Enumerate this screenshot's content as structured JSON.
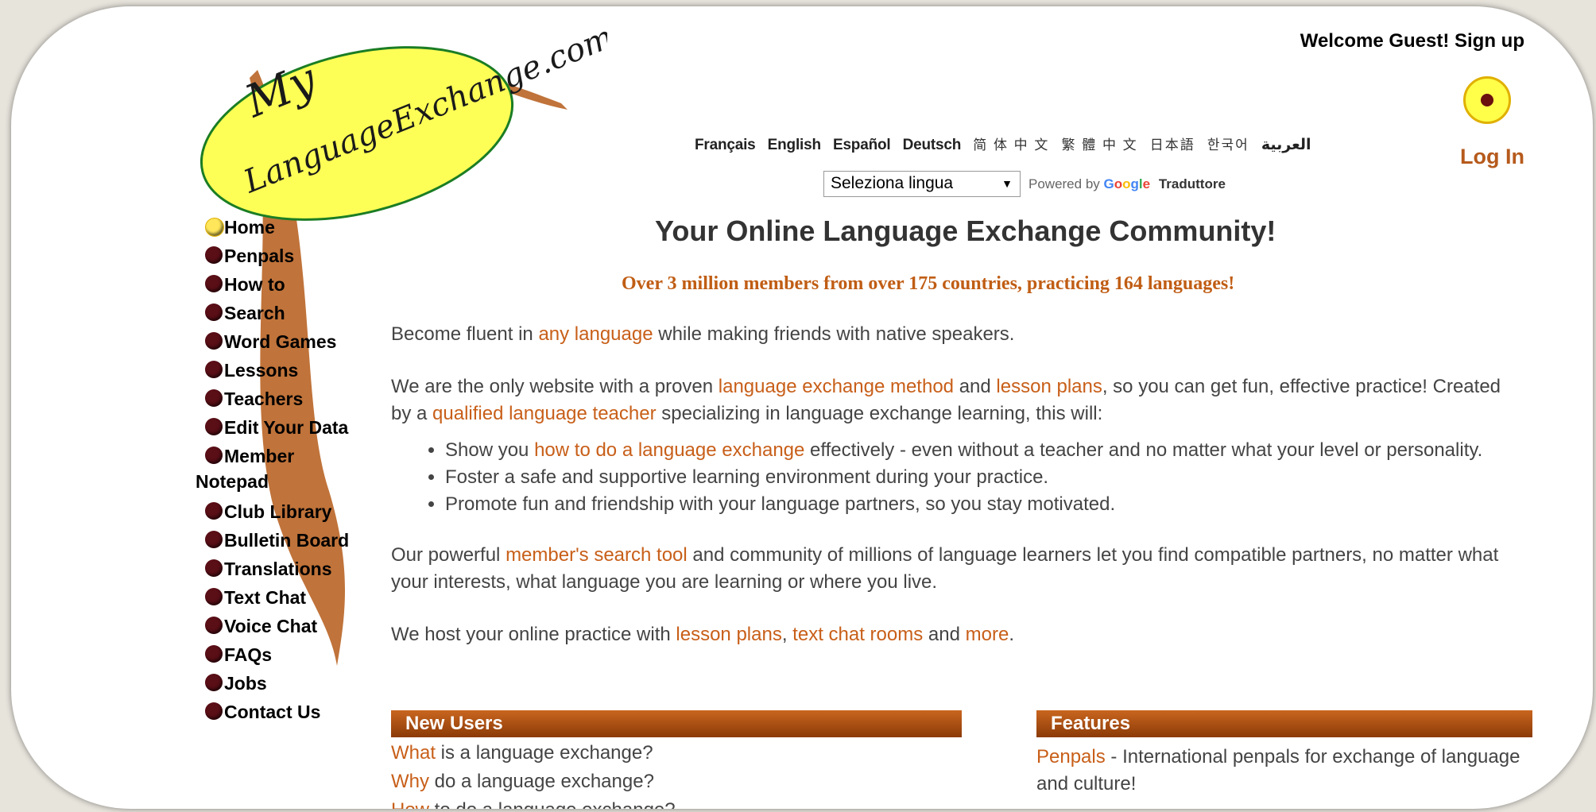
{
  "header": {
    "welcome_text": "Welcome Guest! Sign up",
    "login_label": "Log In"
  },
  "languages": [
    "Français",
    "English",
    "Español",
    "Deutsch",
    "简 体 中 文",
    "繁 體 中 文",
    "日本語",
    "한국어",
    "العربية"
  ],
  "translate": {
    "select_value": "Seleziona lingua",
    "powered_by": "Powered by",
    "google": "Google",
    "translator": "Traduttore"
  },
  "main": {
    "headline": "Your Online Language Exchange Community!",
    "subheadline": "Over 3 million members from over 175 countries, practicing 164 languages!",
    "p1": {
      "a": "Become fluent in ",
      "link1": "any language",
      "b": " while making friends with native speakers."
    },
    "p2": {
      "a": "We are the only website with a proven ",
      "link1": "language exchange method",
      "b": " and ",
      "link2": "lesson plans",
      "c": ", so you can get fun, effective practice! Created by a ",
      "link3": "qualified language teacher",
      "d": " specializing in language exchange learning, this will:"
    },
    "bullets": {
      "b1a": "Show you ",
      "b1link": "how to do a language exchange",
      "b1b": " effectively - even without a teacher and no matter what your level or personality.",
      "b2": "Foster a safe and supportive learning environment during your practice.",
      "b3": "Promote fun and friendship with your language partners, so you stay motivated."
    },
    "p3": {
      "a": "Our powerful ",
      "link1": "member's search tool",
      "b": " and community of millions of language learners let you find compatible partners, no matter what your interests, what language you are learning or where you live."
    },
    "p4": {
      "a": "We host your online practice with ",
      "link1": "lesson plans",
      "b": ", ",
      "link2": "text chat rooms",
      "c": " and ",
      "link3": "more",
      "d": "."
    }
  },
  "nav": {
    "home": "Home",
    "penpals": "Penpals",
    "howto": "How to",
    "search": "Search",
    "wordgames": "Word Games",
    "lessons": "Lessons",
    "teachers": "Teachers",
    "edit": "Edit Your Data",
    "member1": "Member",
    "member2": "Notepad",
    "club": "Club Library",
    "bulletin": "Bulletin Board",
    "translations": "Translations",
    "textchat": "Text Chat",
    "voicechat": "Voice Chat",
    "faqs": "FAQs",
    "jobs": "Jobs",
    "contact": "Contact Us"
  },
  "logo": {
    "text1": "My",
    "text2": "LanguageExchange.com"
  },
  "new_users": {
    "title": "New Users",
    "l1link": "What",
    "l1": " is a language exchange?",
    "l2link": "Why",
    "l2": " do a language exchange?",
    "l3link": "How",
    "l3": " to do a language exchange?"
  },
  "features": {
    "title": "Features",
    "f1link": "Penpals",
    "f1": " - International penpals for exchange of language and culture!"
  },
  "colors": {
    "accent": "#c85f19",
    "nav_dot": "#5a0e16",
    "home_dot": "#ffe65a"
  }
}
